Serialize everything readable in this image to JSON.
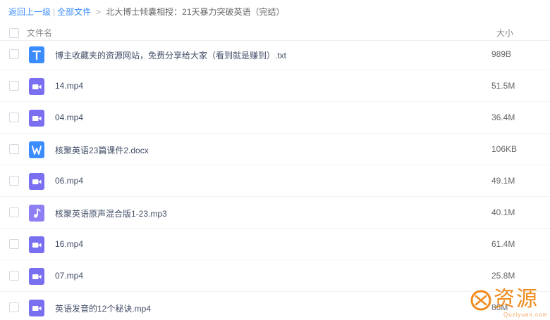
{
  "breadcrumb": {
    "back": "返回上一级",
    "separator": "|",
    "all_files": "全部文件",
    "arrow": ">",
    "current": "北大博士倾囊相授：21天暴力突破英语（完结）"
  },
  "header": {
    "name_col": "文件名",
    "size_col": "大小"
  },
  "files": [
    {
      "name": "博主收藏夹的资源网站，免费分享给大家（看到就是赚到）.txt",
      "size": "989B",
      "icon": "text-file-icon"
    },
    {
      "name": "14.mp4",
      "size": "51.5M",
      "icon": "video-file-icon"
    },
    {
      "name": "04.mp4",
      "size": "36.4M",
      "icon": "video-file-icon"
    },
    {
      "name": "核聚英语23篇课件2.docx",
      "size": "106KB",
      "icon": "word-file-icon"
    },
    {
      "name": "06.mp4",
      "size": "49.1M",
      "icon": "video-file-icon"
    },
    {
      "name": "核聚英语原声混合版1-23.mp3",
      "size": "40.1M",
      "icon": "audio-file-icon"
    },
    {
      "name": "16.mp4",
      "size": "61.4M",
      "icon": "video-file-icon"
    },
    {
      "name": "07.mp4",
      "size": "25.8M",
      "icon": "video-file-icon"
    },
    {
      "name": "英语发音的12个秘诀.mp4",
      "size": "86M",
      "icon": "video-file-icon"
    }
  ],
  "watermark": {
    "text": "资源",
    "subtext": "Quziyuan.com"
  },
  "colors": {
    "link": "#3b8cff",
    "text_icon": "#3b8cff",
    "word_icon": "#3b8cff",
    "video_icon": "#7a6ff0",
    "audio_icon": "#8f7ff5",
    "watermark": "#f08a1c"
  }
}
